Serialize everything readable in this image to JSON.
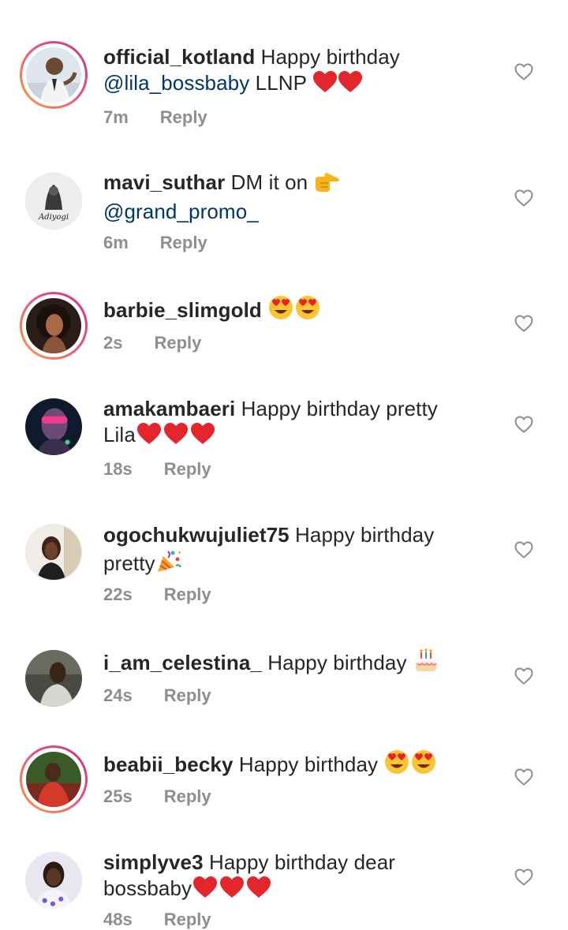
{
  "reply_label": "Reply",
  "comments": [
    {
      "username": "official_kotland",
      "text_before": " Happy birthday",
      "mention": "@lila_bossbaby",
      "text_after": "  LLNP ",
      "emoji": [
        "heart",
        "heart"
      ],
      "time": "7m",
      "story_ring": true
    },
    {
      "username": "mavi_suthar",
      "text_before": " DM it on ",
      "mention": "@grand_promo_",
      "text_after": "",
      "emoji": [
        "point-right"
      ],
      "time": "6m",
      "story_ring": false,
      "avatar_text": "Adiyogi"
    },
    {
      "username": "barbie_slimgold",
      "text_before": " ",
      "emoji": [
        "heart-eyes",
        "heart-eyes"
      ],
      "time": "2s",
      "story_ring": true
    },
    {
      "username": "amakambaeri",
      "text_before": " Happy birthday pretty",
      "text_line2": "Lila",
      "emoji": [
        "heart",
        "heart",
        "heart"
      ],
      "time": "18s",
      "story_ring": false
    },
    {
      "username": "ogochukwujuliet75",
      "text_before": " Happy birthday",
      "text_line2": "pretty",
      "emoji": [
        "party"
      ],
      "time": "22s",
      "story_ring": false
    },
    {
      "username": "i_am_celestina_",
      "text_before": " Happy birthday ",
      "emoji": [
        "cake"
      ],
      "time": "24s",
      "story_ring": false
    },
    {
      "username": "beabii_becky",
      "text_before": " Happy birthday ",
      "emoji": [
        "heart-eyes",
        "heart-eyes"
      ],
      "time": "25s",
      "story_ring": true
    },
    {
      "username": "simplyve3",
      "text_before": " Happy birthday dear",
      "text_line2": "bossbaby",
      "emoji": [
        "heart",
        "heart",
        "heart"
      ],
      "time": "48s",
      "story_ring": false
    }
  ]
}
